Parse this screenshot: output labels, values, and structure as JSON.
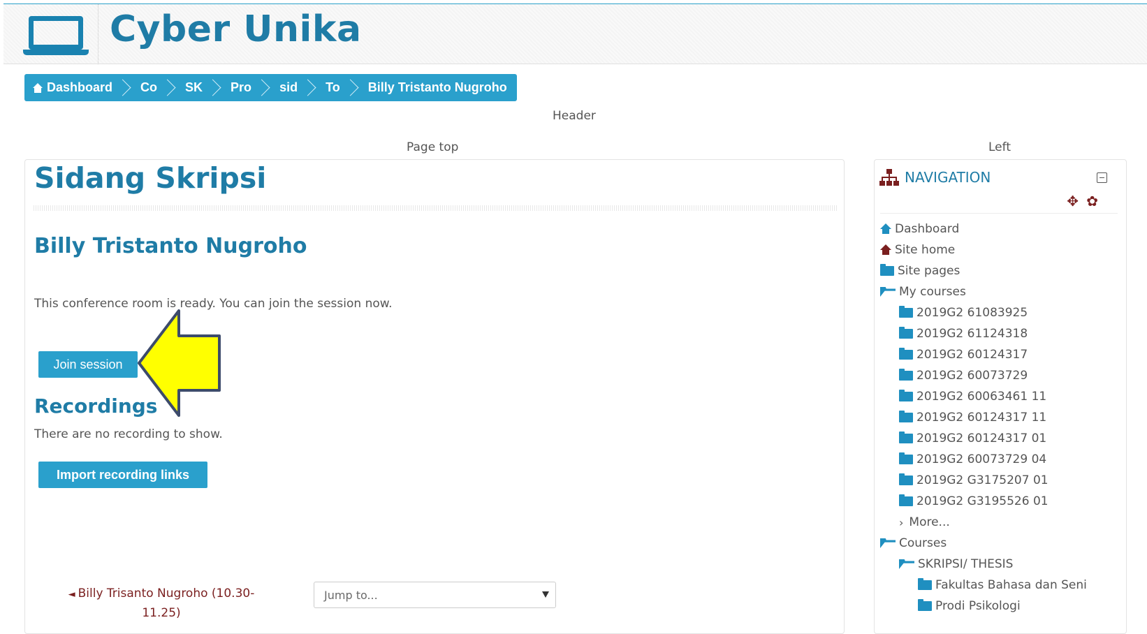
{
  "site": {
    "title": "Cyber Unika"
  },
  "breadcrumb": [
    {
      "label": "Dashboard"
    },
    {
      "label": "Co"
    },
    {
      "label": "SK"
    },
    {
      "label": "Pro"
    },
    {
      "label": "sid"
    },
    {
      "label": "To"
    },
    {
      "label": "Billy Tristanto Nugroho"
    }
  ],
  "regions": {
    "header": "Header",
    "page_top": "Page top",
    "left": "Left"
  },
  "main": {
    "heading": "Sidang Skripsi",
    "session_title": "Billy Tristanto Nugroho",
    "status_message": "This conference room is ready. You can join the session now.",
    "join_button": "Join session",
    "recordings_heading": "Recordings",
    "no_recordings": "There are no recording to show.",
    "import_button": "Import recording links",
    "prev_activity_line1": "Billy Trisanto Nugroho (10.30-",
    "prev_activity_line2": "11.25)",
    "jump_to": "Jump to..."
  },
  "navigation": {
    "title": "NAVIGATION",
    "items": [
      {
        "label": "Dashboard",
        "icon": "house-icon"
      },
      {
        "label": "Site home",
        "icon": "house-icon"
      },
      {
        "label": "Site pages",
        "icon": "folder-icon"
      },
      {
        "label": "My courses",
        "icon": "folder-open-icon"
      },
      {
        "label": "2019G2 61083925",
        "icon": "folder-icon"
      },
      {
        "label": "2019G2 61124318",
        "icon": "folder-icon"
      },
      {
        "label": "2019G2 60124317",
        "icon": "folder-icon"
      },
      {
        "label": "2019G2 60073729",
        "icon": "folder-icon"
      },
      {
        "label": "2019G2 60063461 11",
        "icon": "folder-icon"
      },
      {
        "label": "2019G2 60124317 11",
        "icon": "folder-icon"
      },
      {
        "label": "2019G2 60124317 01",
        "icon": "folder-icon"
      },
      {
        "label": "2019G2 60073729 04",
        "icon": "folder-icon"
      },
      {
        "label": "2019G2 G3175207 01",
        "icon": "folder-icon"
      },
      {
        "label": "2019G2 G3195526 01",
        "icon": "folder-icon"
      },
      {
        "label": "More...",
        "icon": "chevron-right-icon"
      },
      {
        "label": "Courses",
        "icon": "folder-open-icon"
      },
      {
        "label": "SKRIPSI/ THESIS",
        "icon": "folder-open-icon"
      },
      {
        "label": "Fakultas Bahasa dan Seni",
        "icon": "folder-icon"
      },
      {
        "label": "Prodi Psikologi",
        "icon": "folder-icon"
      }
    ]
  },
  "colors": {
    "accent": "#2aa0cc",
    "heading": "#1f7ca6",
    "link": "#7a1f1f",
    "callout": "#ffff00"
  }
}
